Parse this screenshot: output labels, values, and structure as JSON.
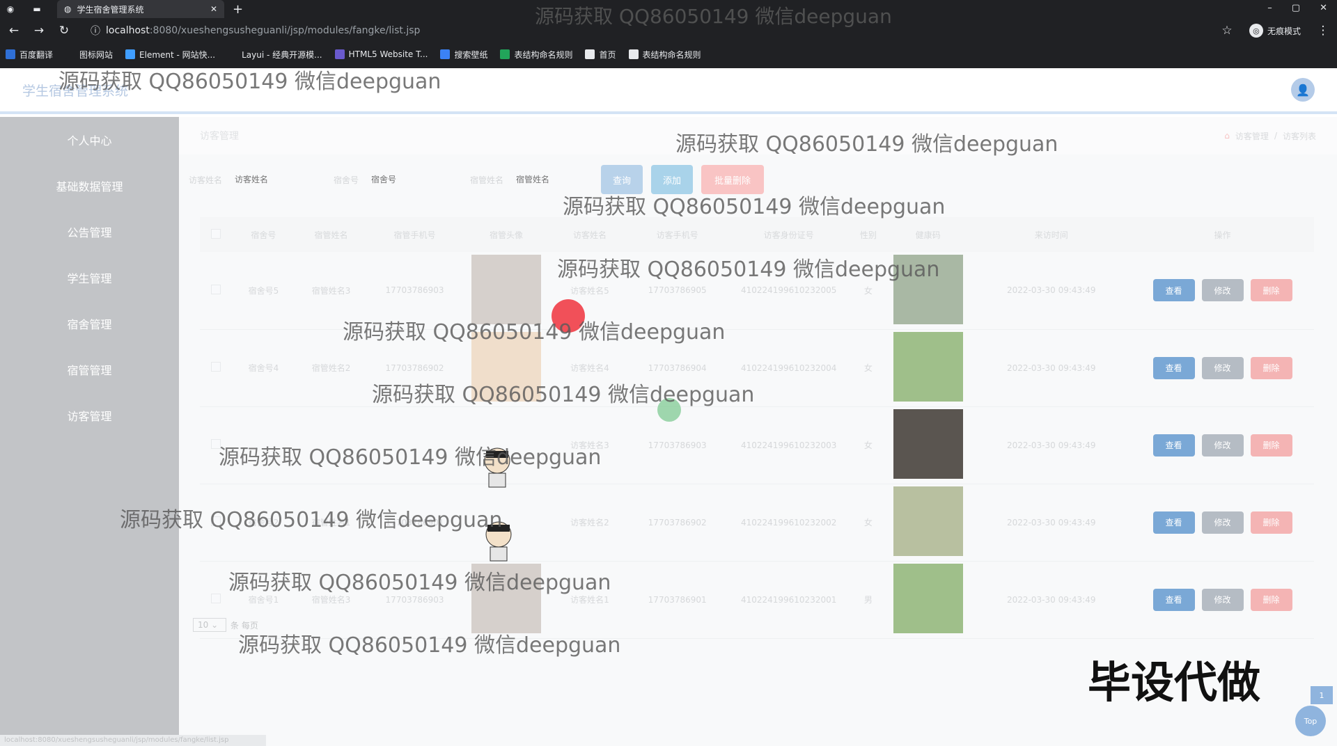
{
  "browser": {
    "tab_title": "学生宿舍管理系统",
    "url_host": "localhost",
    "url_path": ":8080/xueshengsusheguanli/jsp/modules/fangke/list.jsp",
    "incognito": "无痕模式",
    "window_controls": [
      "–",
      "▢",
      "✕"
    ],
    "bookmarks": [
      {
        "label": "百度翻译",
        "color": "#2f6fd6"
      },
      {
        "label": "图标网站",
        "color": "#202124"
      },
      {
        "label": "Element - 网站快...",
        "color": "#409eff"
      },
      {
        "label": "Layui - 经典开源模...",
        "color": "#202124"
      },
      {
        "label": "HTML5 Website T...",
        "color": "#6a5acd"
      },
      {
        "label": "搜索壁纸",
        "color": "#3b82f6"
      },
      {
        "label": "表结构命名规则",
        "color": "#22a55a"
      },
      {
        "label": "首页",
        "color": "#e8eaed"
      },
      {
        "label": "表结构命名规则",
        "color": "#e8eaed"
      }
    ]
  },
  "header": {
    "title": "学生宿舍管理系统"
  },
  "sidebar": {
    "items": [
      {
        "label": "个人中心"
      },
      {
        "label": "基础数据管理"
      },
      {
        "label": "公告管理"
      },
      {
        "label": "学生管理"
      },
      {
        "label": "宿舍管理"
      },
      {
        "label": "宿管管理"
      },
      {
        "label": "访客管理"
      }
    ]
  },
  "page": {
    "title": "访客管理",
    "breadcrumb": [
      "访客管理",
      "访客列表"
    ]
  },
  "search": {
    "fields": [
      {
        "label": "访客姓名",
        "placeholder": "访客姓名"
      },
      {
        "label": "宿舍号",
        "placeholder": "宿舍号"
      },
      {
        "label": "宿管姓名",
        "placeholder": "宿管姓名"
      }
    ],
    "query_label": "查询",
    "add_label": "添加",
    "batch_delete_label": "批量删除"
  },
  "table": {
    "columns": [
      "宿舍号",
      "宿管姓名",
      "宿管手机号",
      "宿管头像",
      "访客姓名",
      "访客手机号",
      "访客身份证号",
      "性别",
      "健康码",
      "来访时间",
      "操作"
    ],
    "actions": {
      "view": "查看",
      "edit": "修改",
      "delete": "删除"
    },
    "rows": [
      {
        "room": "宿舍号5",
        "keeper": "宿管姓名3",
        "keeper_phone": "17703786903",
        "visitor": "访客姓名5",
        "visitor_phone": "17703786905",
        "id_card": "410224199610232005",
        "gender": "女",
        "time": "2022-03-30 09:43:49",
        "avatar_tone": "#b9aea6",
        "code_tone": "#a9b8a4"
      },
      {
        "room": "宿舍号4",
        "keeper": "宿管姓名2",
        "keeper_phone": "17703786902",
        "visitor": "访客姓名4",
        "visitor_phone": "17703786904",
        "id_card": "410224199610232004",
        "gender": "女",
        "time": "2022-03-30 09:43:49",
        "avatar_tone": "#e9c8a4",
        "code_tone": "#9fbf8a"
      },
      {
        "room": "",
        "keeper": "",
        "keeper_phone": "",
        "visitor": "访客姓名3",
        "visitor_phone": "17703786903",
        "id_card": "410224199610232003",
        "gender": "女",
        "time": "2022-03-30 09:43:49",
        "avatar_tone": "",
        "code_tone": "#5a5550"
      },
      {
        "room": "宿舍号2",
        "keeper": "宿管姓名1",
        "keeper_phone": "17703786901",
        "visitor": "访客姓名2",
        "visitor_phone": "17703786902",
        "id_card": "410224199610232002",
        "gender": "女",
        "time": "2022-03-30 09:43:49",
        "avatar_tone": "",
        "code_tone": "#b8c0a0"
      },
      {
        "room": "宿舍号1",
        "keeper": "宿管姓名3",
        "keeper_phone": "17703786903",
        "visitor": "访客姓名1",
        "visitor_phone": "17703786901",
        "id_card": "410224199610232001",
        "gender": "男",
        "time": "2022-03-30 09:43:49",
        "avatar_tone": "#b9aea6",
        "code_tone": "#9fbf8a"
      }
    ]
  },
  "pager": {
    "page_size": "10",
    "suffix": "条 每页"
  },
  "overlay": {
    "watermark": "源码获取 QQ86050149 微信deepguan",
    "stamp": "毕设代做",
    "top_label": "Top",
    "top_tag": "1",
    "status_url": "localhost:8080/xueshengsusheguanli/jsp/modules/fangke/list.jsp"
  }
}
